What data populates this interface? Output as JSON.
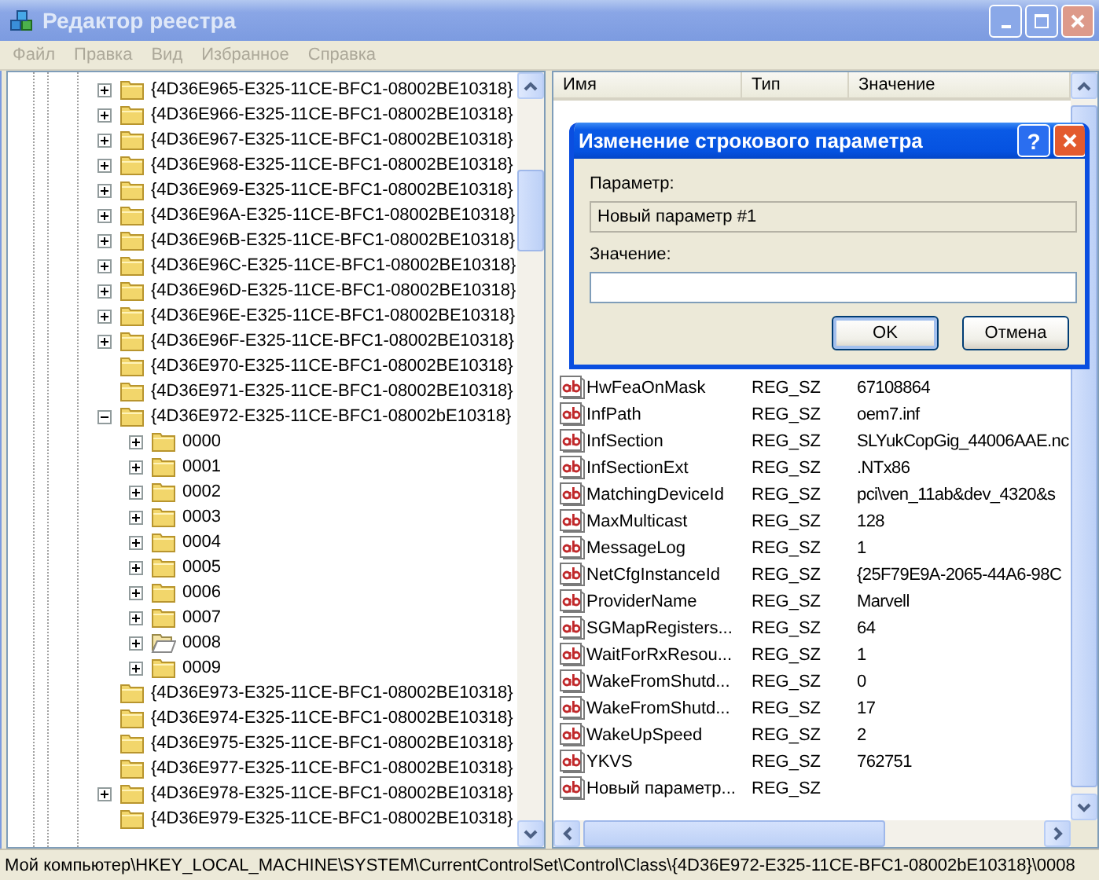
{
  "window": {
    "title": "Редактор реестра"
  },
  "menu": [
    {
      "label": "Файл",
      "disabled": true
    },
    {
      "label": "Правка",
      "disabled": true
    },
    {
      "label": "Вид",
      "disabled": true
    },
    {
      "label": "Избранное",
      "disabled": true
    },
    {
      "label": "Справка",
      "disabled": true
    }
  ],
  "tree": {
    "items": [
      {
        "label": "{4D36E965-E325-11CE-BFC1-08002BE10318}",
        "has_children": true,
        "expanded": false,
        "selected": false
      },
      {
        "label": "{4D36E966-E325-11CE-BFC1-08002BE10318}",
        "has_children": true,
        "expanded": false,
        "selected": false
      },
      {
        "label": "{4D36E967-E325-11CE-BFC1-08002BE10318}",
        "has_children": true,
        "expanded": false,
        "selected": false
      },
      {
        "label": "{4D36E968-E325-11CE-BFC1-08002BE10318}",
        "has_children": true,
        "expanded": false,
        "selected": false
      },
      {
        "label": "{4D36E969-E325-11CE-BFC1-08002BE10318}",
        "has_children": true,
        "expanded": false,
        "selected": false
      },
      {
        "label": "{4D36E96A-E325-11CE-BFC1-08002BE10318}",
        "has_children": true,
        "expanded": false,
        "selected": false
      },
      {
        "label": "{4D36E96B-E325-11CE-BFC1-08002BE10318}",
        "has_children": true,
        "expanded": false,
        "selected": false
      },
      {
        "label": "{4D36E96C-E325-11CE-BFC1-08002BE10318}",
        "has_children": true,
        "expanded": false,
        "selected": false
      },
      {
        "label": "{4D36E96D-E325-11CE-BFC1-08002BE10318}",
        "has_children": true,
        "expanded": false,
        "selected": false
      },
      {
        "label": "{4D36E96E-E325-11CE-BFC1-08002BE10318}",
        "has_children": true,
        "expanded": false,
        "selected": false
      },
      {
        "label": "{4D36E96F-E325-11CE-BFC1-08002BE10318}",
        "has_children": true,
        "expanded": false,
        "selected": false
      },
      {
        "label": "{4D36E970-E325-11CE-BFC1-08002BE10318}",
        "has_children": false,
        "selected": false
      },
      {
        "label": "{4D36E971-E325-11CE-BFC1-08002BE10318}",
        "has_children": false,
        "selected": false
      },
      {
        "label": "{4D36E972-E325-11CE-BFC1-08002bE10318}",
        "has_children": true,
        "expanded": true,
        "selected": false,
        "children": [
          {
            "label": "0000",
            "has_children": true,
            "expanded": false,
            "selected": false
          },
          {
            "label": "0001",
            "has_children": true,
            "expanded": false,
            "selected": false
          },
          {
            "label": "0002",
            "has_children": true,
            "expanded": false,
            "selected": false
          },
          {
            "label": "0003",
            "has_children": true,
            "expanded": false,
            "selected": false
          },
          {
            "label": "0004",
            "has_children": true,
            "expanded": false,
            "selected": false
          },
          {
            "label": "0005",
            "has_children": true,
            "expanded": false,
            "selected": false
          },
          {
            "label": "0006",
            "has_children": true,
            "expanded": false,
            "selected": false
          },
          {
            "label": "0007",
            "has_children": true,
            "expanded": false,
            "selected": false
          },
          {
            "label": "0008",
            "has_children": true,
            "expanded": false,
            "selected": true
          },
          {
            "label": "0009",
            "has_children": true,
            "expanded": false,
            "selected": false
          }
        ]
      },
      {
        "label": "{4D36E973-E325-11CE-BFC1-08002BE10318}",
        "has_children": false,
        "selected": false
      },
      {
        "label": "{4D36E974-E325-11CE-BFC1-08002BE10318}",
        "has_children": false,
        "selected": false
      },
      {
        "label": "{4D36E975-E325-11CE-BFC1-08002BE10318}",
        "has_children": false,
        "selected": false
      },
      {
        "label": "{4D36E977-E325-11CE-BFC1-08002BE10318}",
        "has_children": false,
        "selected": false
      },
      {
        "label": "{4D36E978-E325-11CE-BFC1-08002BE10318}",
        "has_children": true,
        "expanded": false,
        "selected": false
      },
      {
        "label": "{4D36E979-E325-11CE-BFC1-08002BE10318}",
        "has_children": false,
        "selected": false
      }
    ]
  },
  "list": {
    "columns": [
      "Имя",
      "Тип",
      "Значение"
    ],
    "rows": [
      {
        "name": "HwFeaOnMask",
        "type": "REG_SZ",
        "value": "67108864"
      },
      {
        "name": "InfPath",
        "type": "REG_SZ",
        "value": "oem7.inf"
      },
      {
        "name": "InfSection",
        "type": "REG_SZ",
        "value": "SLYukCopGig_44006AAE.nc"
      },
      {
        "name": "InfSectionExt",
        "type": "REG_SZ",
        "value": ".NTx86"
      },
      {
        "name": "MatchingDeviceId",
        "type": "REG_SZ",
        "value": "pci\\ven_11ab&dev_4320&s"
      },
      {
        "name": "MaxMulticast",
        "type": "REG_SZ",
        "value": "128"
      },
      {
        "name": "MessageLog",
        "type": "REG_SZ",
        "value": "1"
      },
      {
        "name": "NetCfgInstanceId",
        "type": "REG_SZ",
        "value": "{25F79E9A-2065-44A6-98C"
      },
      {
        "name": "ProviderName",
        "type": "REG_SZ",
        "value": "Marvell"
      },
      {
        "name": "SGMapRegisters...",
        "type": "REG_SZ",
        "value": "64"
      },
      {
        "name": "WaitForRxResou...",
        "type": "REG_SZ",
        "value": "1"
      },
      {
        "name": "WakeFromShutd...",
        "type": "REG_SZ",
        "value": "0"
      },
      {
        "name": "WakeFromShutd...",
        "type": "REG_SZ",
        "value": "17"
      },
      {
        "name": "WakeUpSpeed",
        "type": "REG_SZ",
        "value": "2"
      },
      {
        "name": "YKVS",
        "type": "REG_SZ",
        "value": "762751"
      },
      {
        "name": "Новый параметр...",
        "type": "REG_SZ"
      }
    ]
  },
  "dialog": {
    "title": "Изменение строкового параметра",
    "help_button": "?",
    "name_label": "Параметр:",
    "name_value": "Новый параметр #1",
    "value_label": "Значение:",
    "buttons": [
      {
        "label": "OK",
        "default": true
      },
      {
        "label": "Отмена",
        "default": false
      }
    ]
  },
  "status_bar": "Мой компьютер\\HKEY_LOCAL_MACHINE\\SYSTEM\\CurrentControlSet\\Control\\Class\\{4D36E972-E325-11CE-BFC1-08002bE10318}\\0008"
}
